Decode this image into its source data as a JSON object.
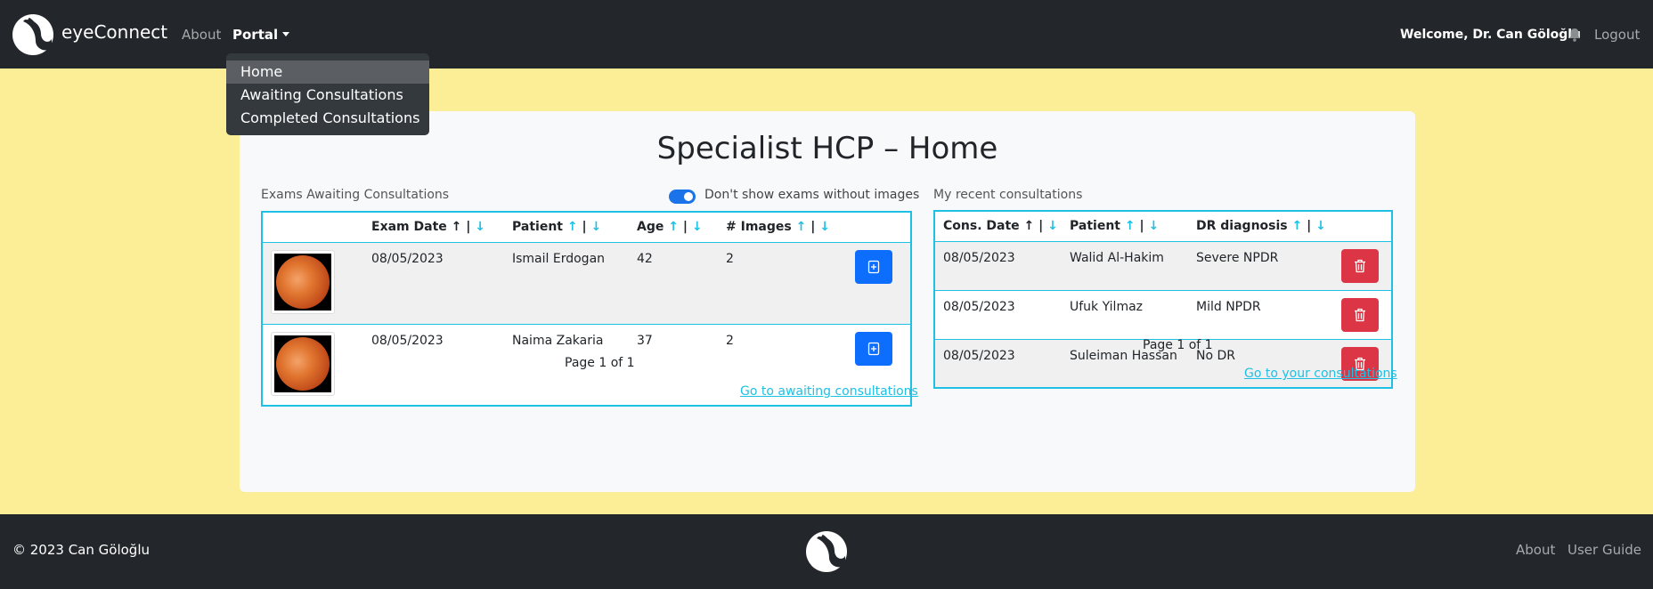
{
  "nav": {
    "brand": "eyeConnect",
    "about": "About",
    "portal": "Portal",
    "welcome": "Welcome, Dr. Can Göloğlu",
    "logout": "Logout"
  },
  "dropdown": {
    "items": [
      "Home",
      "Awaiting Consultations",
      "Completed Consultations"
    ]
  },
  "page": {
    "title": "Specialist HCP – Home"
  },
  "awaiting": {
    "label": "Exams Awaiting Consultations",
    "toggle_label": "Don't show exams without images",
    "headers": [
      "Exam Date",
      "Patient",
      "Age",
      "# Images"
    ],
    "rows": [
      {
        "date": "08/05/2023",
        "patient": "Ismail Erdogan",
        "age": "42",
        "images": "2"
      },
      {
        "date": "08/05/2023",
        "patient": "Naima Zakaria",
        "age": "37",
        "images": "2"
      }
    ],
    "pager": "Page 1 of 1",
    "link": "Go to awaiting consultations"
  },
  "recent": {
    "label": "My recent consultations",
    "headers": [
      "Cons. Date",
      "Patient",
      "DR diagnosis"
    ],
    "rows": [
      {
        "date": "08/05/2023",
        "patient": "Walid Al-Hakim",
        "diagnosis": "Severe NPDR"
      },
      {
        "date": "08/05/2023",
        "patient": "Ufuk Yilmaz",
        "diagnosis": "Mild NPDR"
      },
      {
        "date": "08/05/2023",
        "patient": "Suleiman Hassan",
        "diagnosis": "No DR"
      }
    ],
    "pager": "Page 1 of 1",
    "link": "Go to your consultations"
  },
  "sort": {
    "up": "↑",
    "sep": "|",
    "down": "↓"
  },
  "footer": {
    "copyright": "© 2023 Can Göloğlu",
    "about": "About",
    "guide": "User Guide"
  },
  "colors": {
    "background": "#fbee97",
    "navbar": "#23272b",
    "accent": "#1ec1e4",
    "primary_button": "#0d6efd",
    "danger_button": "#dc3545"
  },
  "icons": {
    "brand": "eye-logo-icon",
    "bell": "bell-icon",
    "add": "add-document-icon",
    "delete": "trash-icon"
  }
}
